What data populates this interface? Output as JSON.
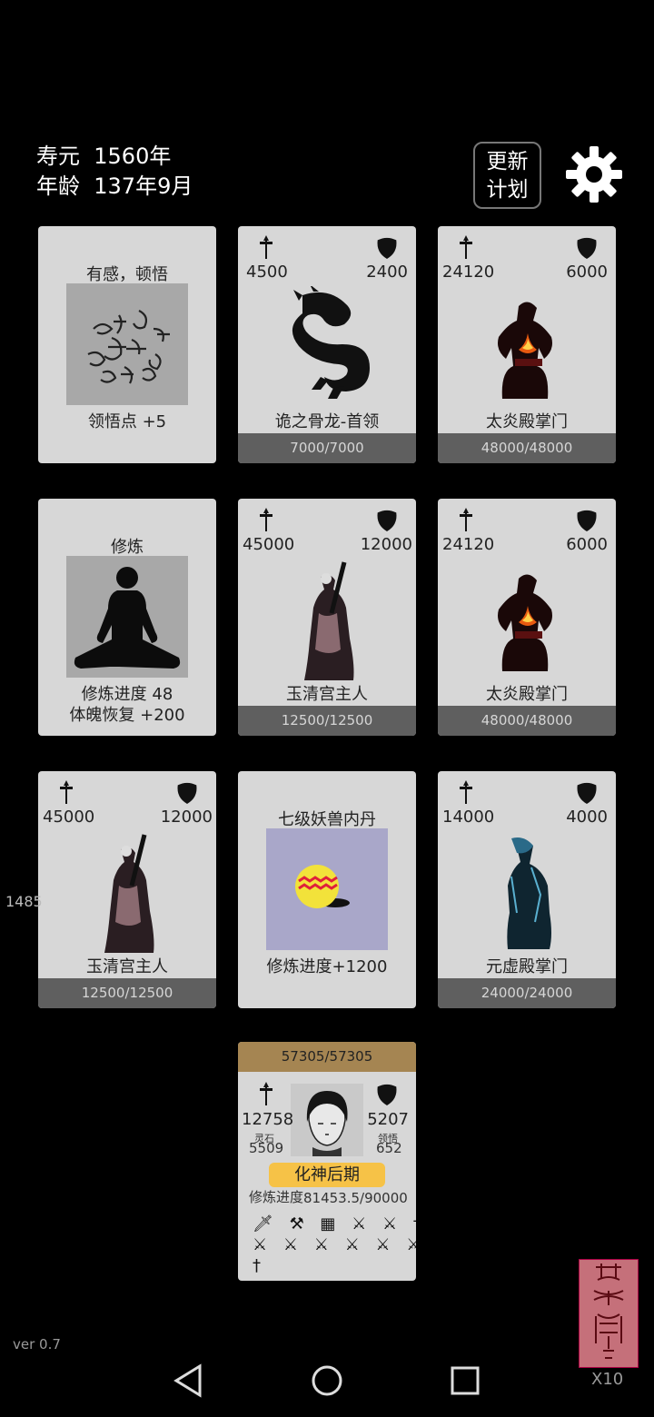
{
  "hud": {
    "lifespan_label": "寿元",
    "lifespan_value": "1560年",
    "age_label": "年龄",
    "age_value": "137年9月",
    "update_line1": "更新",
    "update_line2": "计划"
  },
  "cards": [
    {
      "kind": "event",
      "title": "有感，顿悟",
      "footer": "领悟点  +5"
    },
    {
      "kind": "enemy",
      "atk": "4500",
      "def": "2400",
      "name": "诡之骨龙-首领",
      "hp": "7000/7000"
    },
    {
      "kind": "enemy",
      "atk": "24120",
      "def": "6000",
      "name": "太炎殿掌门",
      "hp": "48000/48000"
    },
    {
      "kind": "event",
      "title": "修炼",
      "footer1": "修炼进度  48",
      "footer2": "体魄恢复  +200"
    },
    {
      "kind": "enemy",
      "atk": "45000",
      "def": "12000",
      "name": "玉清宫主人",
      "hp": "12500/12500"
    },
    {
      "kind": "enemy",
      "atk": "24120",
      "def": "6000",
      "name": "太炎殿掌门",
      "hp": "48000/48000"
    },
    {
      "kind": "enemy",
      "atk": "45000",
      "def": "12000",
      "name": "玉清宫主人",
      "hp": "12500/12500"
    },
    {
      "kind": "item",
      "title": "七级妖兽内丹",
      "footer": "修炼进度+1200"
    },
    {
      "kind": "enemy",
      "atk": "14000",
      "def": "4000",
      "name": "元虚殿掌门",
      "hp": "24000/24000"
    }
  ],
  "side_number": "1485",
  "player": {
    "hp": "57305/57305",
    "atk": "12758",
    "def": "5207",
    "spirit_stone_label": "灵石",
    "spirit_stone_value": "5509",
    "insight_label": "领悟",
    "insight_value": "652",
    "realm": "化神后期",
    "progress_label": "修炼进度",
    "progress_value": "81453.5/90000",
    "weapons_row1": "🗡 ⚒ ▦ ⚔ ⚔ † †",
    "weapons_row2": "⚔ ⚔ ⚔ ⚔ ⚔ ⚔ ⚔",
    "weapons_row3": "†"
  },
  "version": "ver 0.7",
  "stamp_multiplier": "X10",
  "colors": {
    "background": "#000000",
    "card": "#d7d7d7",
    "hp_bar": "#5f5f5f",
    "player_hp_bar": "#a58552",
    "realm_badge": "#f6c247",
    "item_bg": "#a9a7c9"
  },
  "icons": [
    "attack-sword-icon",
    "defense-shield-icon",
    "settings-gear-icon",
    "back-nav-icon",
    "home-nav-icon",
    "recents-nav-icon"
  ]
}
